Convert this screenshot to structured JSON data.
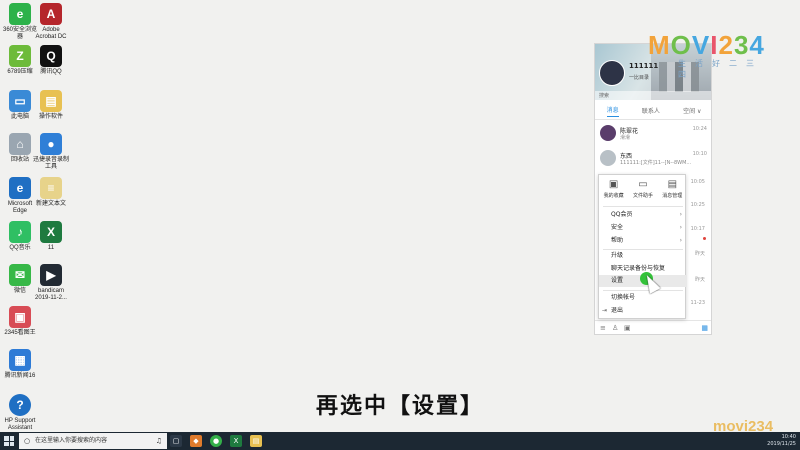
{
  "desktop": {
    "icons": [
      {
        "label": "360安全浏览\n器",
        "glyph": "e",
        "color": "#2db24a"
      },
      {
        "label": "Adobe\nAcrobat DC",
        "glyph": "A",
        "color": "#b5262b"
      },
      {
        "label": "6789压缩",
        "glyph": "Z",
        "color": "#6dbb3a"
      },
      {
        "label": "腾讯QQ",
        "glyph": "Q",
        "color": "#111111"
      },
      {
        "label": "此电脑",
        "glyph": "▭",
        "color": "#3a8ad6"
      },
      {
        "label": "操作软件",
        "glyph": "▤",
        "color": "#e8c152"
      },
      {
        "label": "回收站",
        "glyph": "⌂",
        "color": "#9aa6b1"
      },
      {
        "label": "迅捷录音录制\n工具",
        "glyph": "●",
        "color": "#2f7fd7"
      },
      {
        "label": "Microsoft\nEdge",
        "glyph": "e",
        "color": "#1f6fc3"
      },
      {
        "label": "新建文本文",
        "glyph": "≡",
        "color": "#e7d38a"
      },
      {
        "label": "QQ音乐",
        "glyph": "♪",
        "color": "#2fbf63"
      },
      {
        "label": "11",
        "glyph": "X",
        "color": "#1e7a3f"
      },
      {
        "label": "微信",
        "glyph": "✉",
        "color": "#37b847"
      },
      {
        "label": "bandicam\n2019-11-2...",
        "glyph": "▶",
        "color": "#222a33"
      },
      {
        "label": "2345看图王",
        "glyph": "▣",
        "color": "#d84c55"
      },
      {
        "label": "腾讯新闻16",
        "glyph": "▦",
        "color": "#2e7bd6"
      },
      {
        "label": "HP Support\nAssistant",
        "glyph": "?",
        "color": "#1f6fc3"
      }
    ]
  },
  "watermark": {
    "main": [
      "M",
      "O",
      "V",
      "I",
      "2",
      "3",
      "4"
    ],
    "sub": "生活好二三四",
    "corner": "movi234"
  },
  "qq": {
    "name": "111111",
    "signature": "一比目录",
    "search_placeholder": "搜索",
    "tabs": [
      "消息",
      "联系人",
      "空间 ∨"
    ],
    "conversations": [
      {
        "name": "陈翠花",
        "message": "滑滑",
        "time": "10:24",
        "color": "#5a3d6b"
      },
      {
        "name": "东西",
        "message": "111111:[文件]11--[N--8WM...",
        "time": "10:10",
        "color": "#b8c0c6"
      }
    ],
    "side_times": [
      "10:05",
      "10:25",
      "10:17",
      "昨天",
      "昨天",
      "11-23"
    ]
  },
  "menu": {
    "top": [
      {
        "icon": "▣",
        "label": "我的收藏"
      },
      {
        "icon": "▭",
        "label": "文件助手"
      },
      {
        "icon": "▤",
        "label": "消息管理"
      }
    ],
    "items": [
      {
        "label": "QQ会员",
        "arrow": "›"
      },
      {
        "label": "安全",
        "arrow": "›"
      },
      {
        "label": "帮助",
        "arrow": "›"
      },
      {
        "label": "升级",
        "arrow": ""
      },
      {
        "label": "聊天记录备份与恢复",
        "arrow": ""
      },
      {
        "label": "设置",
        "arrow": ""
      },
      {
        "label": "切换帐号",
        "arrow": ""
      },
      {
        "label": "退出",
        "arrow": ""
      }
    ],
    "highlighted": "设置"
  },
  "subtitle": "再选中【设置】",
  "taskbar": {
    "search_placeholder": "在这里输入你要搜索的内容",
    "tray_time": "10:40",
    "tray_date": "2019/11/25",
    "apps": [
      {
        "glyph": "▢",
        "color": "#2b3846"
      },
      {
        "glyph": "◆",
        "color": "#e07b2c"
      },
      {
        "glyph": "●",
        "color": "#34b04a"
      },
      {
        "glyph": "X",
        "color": "#1e7a3f"
      },
      {
        "glyph": "▤",
        "color": "#e8c152"
      }
    ]
  },
  "colors": {
    "accent": "#2a8fe0",
    "cursor": "#34c23a"
  }
}
